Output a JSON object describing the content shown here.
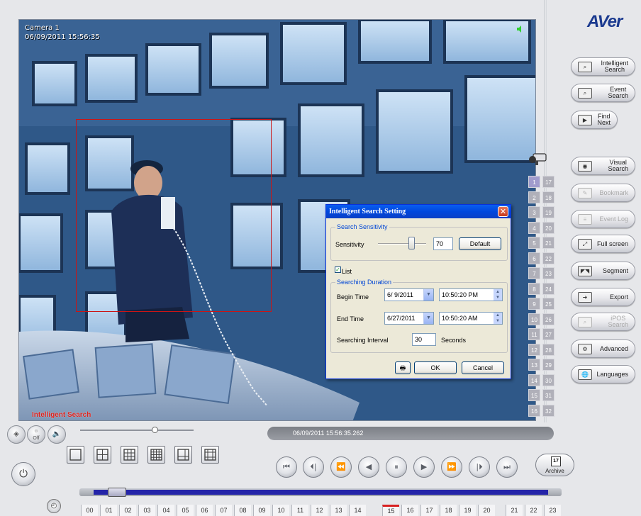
{
  "camera_view": {
    "camera_name": "Camera 1",
    "timestamp": "06/09/2011 15:56:35",
    "mode_label": "Intelligent Search"
  },
  "dialog": {
    "title": "Intelligent Search Setting",
    "close_icon": "close-icon",
    "sensitivity_group": "Search Sensitivity",
    "sensitivity_label": "Sensitivity",
    "sensitivity_value": "70",
    "sensitivity_level": 70,
    "default_button": "Default",
    "list_label": "List",
    "list_checked": true,
    "duration_group": "Searching Duration",
    "begin_label": "Begin Time",
    "begin_date": "6/ 9/2011",
    "begin_time": "10:50:20 PM",
    "end_label": "End Time",
    "end_date": "6/27/2011",
    "end_time": "10:50:20 AM",
    "interval_label": "Searching Interval",
    "interval_value": "30",
    "interval_unit": "Seconds",
    "ok_button": "OK",
    "cancel_button": "Cancel"
  },
  "brand": {
    "logo": "AVer",
    "color": "#1b3a8f"
  },
  "right_panel": {
    "search_buttons": [
      {
        "label": "Intelligent\nSearch",
        "icon": "intelligent-search-icon"
      },
      {
        "label": "Event\nSearch",
        "icon": "event-search-icon"
      },
      {
        "label": "Find\nNext",
        "icon": "find-next-icon"
      }
    ],
    "tool_buttons": [
      {
        "label": "Visual\nSearch",
        "icon": "visual-search-icon",
        "enabled": true
      },
      {
        "label": "Bookmark",
        "icon": "bookmark-icon",
        "enabled": false
      },
      {
        "label": "Event Log",
        "icon": "event-log-icon",
        "enabled": false
      },
      {
        "label": "Full screen",
        "icon": "full-screen-icon",
        "enabled": true
      },
      {
        "label": "Segment",
        "icon": "segment-icon",
        "enabled": true
      },
      {
        "label": "Export",
        "icon": "export-icon",
        "enabled": true
      },
      {
        "label": "iPOS\nSearch",
        "icon": "ipos-search-icon",
        "enabled": false
      },
      {
        "label": "Advanced",
        "icon": "advanced-icon",
        "enabled": true
      },
      {
        "label": "Languages",
        "icon": "languages-icon",
        "enabled": true
      }
    ],
    "channels_left": [
      "1",
      "2",
      "3",
      "4",
      "5",
      "6",
      "7",
      "8",
      "9",
      "10",
      "11",
      "12",
      "13",
      "14",
      "15",
      "16"
    ],
    "channels_right": [
      "17",
      "18",
      "19",
      "20",
      "21",
      "22",
      "23",
      "24",
      "25",
      "26",
      "27",
      "28",
      "29",
      "30",
      "31",
      "32"
    ],
    "selected_channel": "1"
  },
  "playback": {
    "time_readout": "06/09/2011 15:56:35.262",
    "volume_level": 0.63,
    "audio_off_label": "Off",
    "controls": [
      "first-frame",
      "step-back",
      "fast-rewind",
      "play-reverse",
      "pause",
      "play",
      "fast-forward",
      "step-forward",
      "last-frame"
    ],
    "control_glyphs": [
      "⏮",
      "⏴|",
      "⏪",
      "◀",
      "⏸",
      "▶",
      "⏩",
      "|⏵",
      "⏭"
    ],
    "archive_label": "Archive",
    "archive_day": "17",
    "hours": [
      "00",
      "01",
      "02",
      "03",
      "04",
      "05",
      "06",
      "07",
      "08",
      "09",
      "10",
      "11",
      "12",
      "13",
      "14",
      "15",
      "16",
      "17",
      "18",
      "19",
      "20",
      "21",
      "22",
      "23"
    ],
    "current_hour": "15",
    "timeline_position": 0.06
  }
}
